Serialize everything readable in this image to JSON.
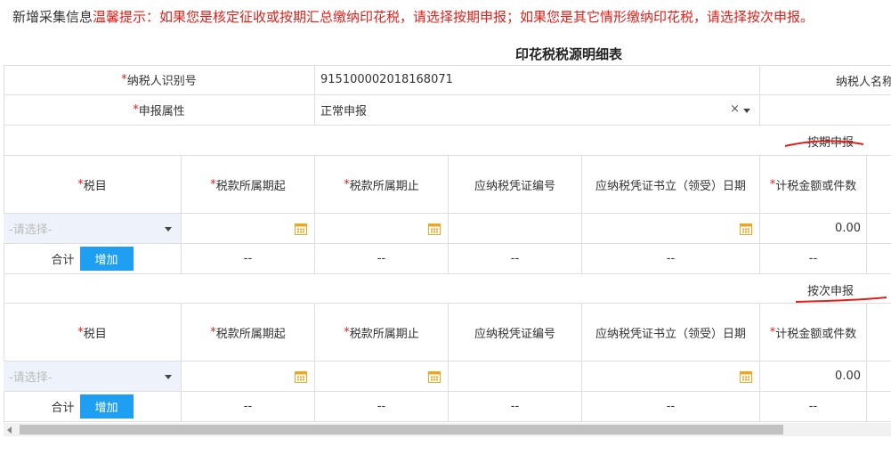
{
  "hint": {
    "label": "新增采集信息",
    "text": "温馨提示：如果您是核定征收或按期汇总缴纳印花税，请选择按期申报；如果您是其它情形缴纳印花税，请选择按次申报。"
  },
  "form_title": "印花税税源明细表",
  "info": {
    "taxpayer_id_label": "纳税人识别号",
    "taxpayer_id_value": "915100002018168071",
    "taxpayer_name_label": "纳税人名称",
    "attr_label": "申报属性",
    "attr_value": "正常申报",
    "clear_symbol": "×"
  },
  "columns": [
    "税目",
    "税款所属期起",
    "税款所属期止",
    "应纳税凭证编号",
    "应纳税凭证书立（领受）日期",
    "计税金额或件数"
  ],
  "required_marker": "*",
  "sections": [
    {
      "header": "按期申报",
      "select_placeholder": "-请选择-",
      "amount": "0.00",
      "total_label": "合计",
      "add_label": "增加",
      "dash": "--"
    },
    {
      "header": "按次申报",
      "select_placeholder": "-请选择-",
      "amount": "0.00",
      "total_label": "合计",
      "add_label": "增加",
      "dash": "--"
    }
  ],
  "colors": {
    "required": "#e0201b",
    "button": "#1e9ff2",
    "calendar_icon": "#f0a51c",
    "annotation": "#e0201b"
  }
}
